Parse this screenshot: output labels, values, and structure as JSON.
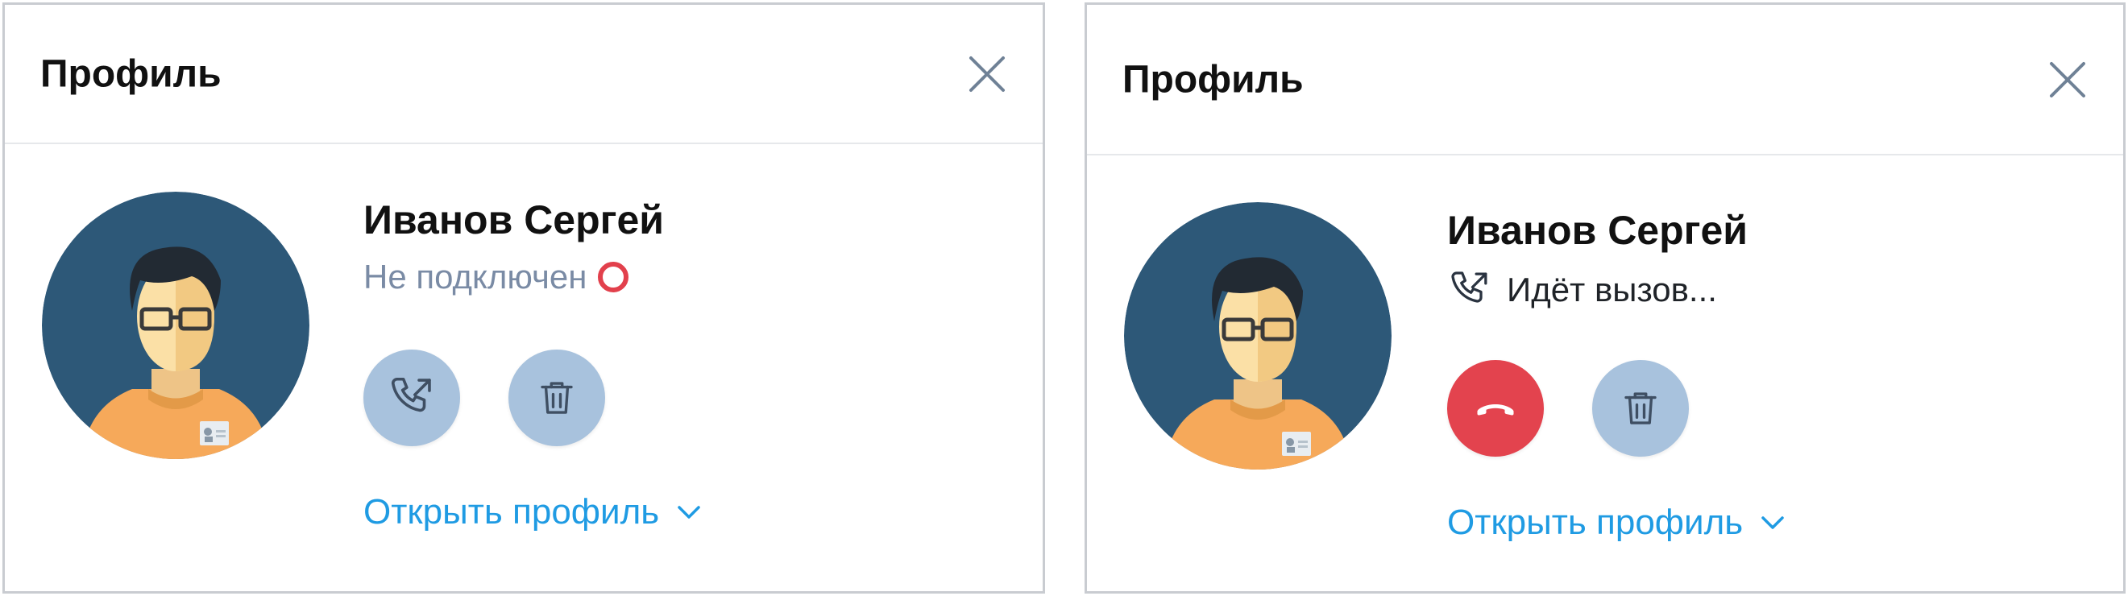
{
  "panels": [
    {
      "header": {
        "title": "Профиль"
      },
      "user": {
        "name": "Иванов Сергей"
      },
      "status": {
        "text": "Не подключен",
        "state": "offline",
        "indicator_color": "#e2404c"
      },
      "actions": [
        {
          "name": "call",
          "icon": "phone-outgoing-icon",
          "color": "#a8c2dd"
        },
        {
          "name": "delete",
          "icon": "trash-icon",
          "color": "#a8c2dd"
        }
      ],
      "link": {
        "label": "Открыть профиль"
      }
    },
    {
      "header": {
        "title": "Профиль"
      },
      "user": {
        "name": "Иванов Сергей"
      },
      "status": {
        "text": "Идёт вызов...",
        "state": "calling",
        "icon": "phone-outgoing-icon"
      },
      "actions": [
        {
          "name": "hang-up",
          "icon": "phone-hangup-icon",
          "color": "#e3434e"
        },
        {
          "name": "delete",
          "icon": "trash-icon",
          "color": "#a8c2dd"
        }
      ],
      "link": {
        "label": "Открыть профиль"
      }
    }
  ],
  "colors": {
    "accent_link": "#1f9be3",
    "avatar_bg": "#2d5878",
    "button_blue": "#a8c2dd",
    "button_red": "#e3434e",
    "status_offline_text": "#7a8ba5"
  }
}
